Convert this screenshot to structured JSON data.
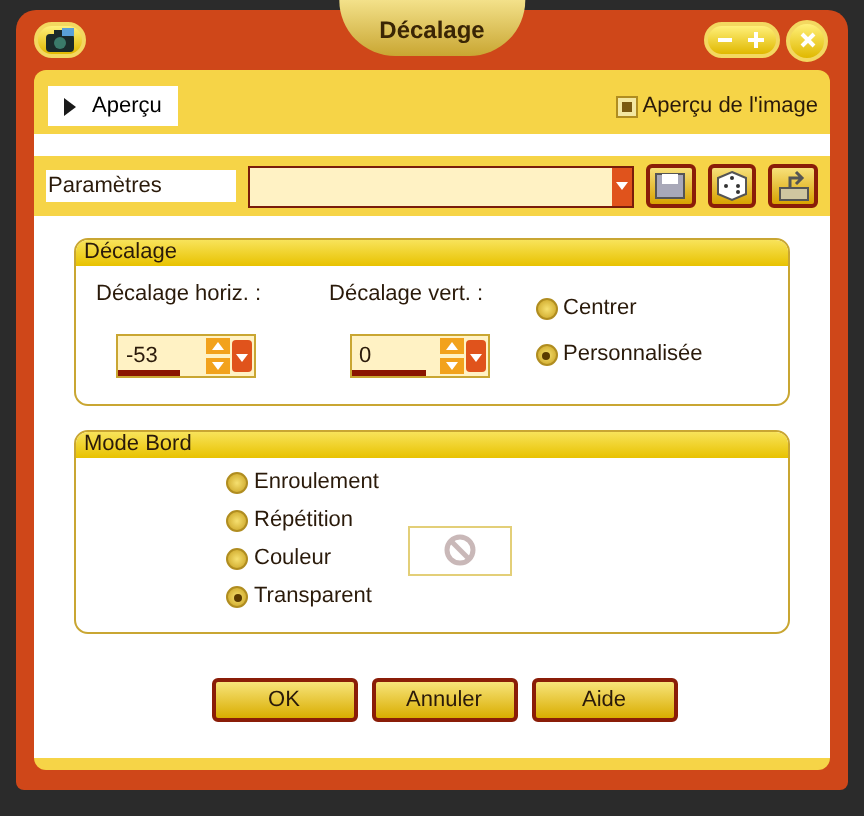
{
  "window": {
    "title": "Décalage"
  },
  "preview": {
    "label": "Aperçu",
    "expanded": false
  },
  "image_preview": {
    "label": "Aperçu de l'image",
    "checked": true
  },
  "presets": {
    "label": "Paramètres"
  },
  "offset_group": {
    "title": "Décalage",
    "fields": [
      {
        "label": "Décalage horiz. :",
        "value": "-53",
        "level": 0.45
      },
      {
        "label": "Décalage vert. :",
        "value": "0",
        "level": 0.55
      }
    ],
    "options": [
      {
        "label": "Centrer",
        "selected": false
      },
      {
        "label": "Personnalisée",
        "selected": true
      }
    ]
  },
  "edge_group": {
    "title": "Mode Bord",
    "options": [
      {
        "label": "Enroulement",
        "selected": false
      },
      {
        "label": "Répétition",
        "selected": false
      },
      {
        "label": "Couleur",
        "selected": false
      },
      {
        "label": "Transparent",
        "selected": true
      }
    ]
  },
  "buttons": [
    "OK",
    "Annuler",
    "Aide"
  ]
}
